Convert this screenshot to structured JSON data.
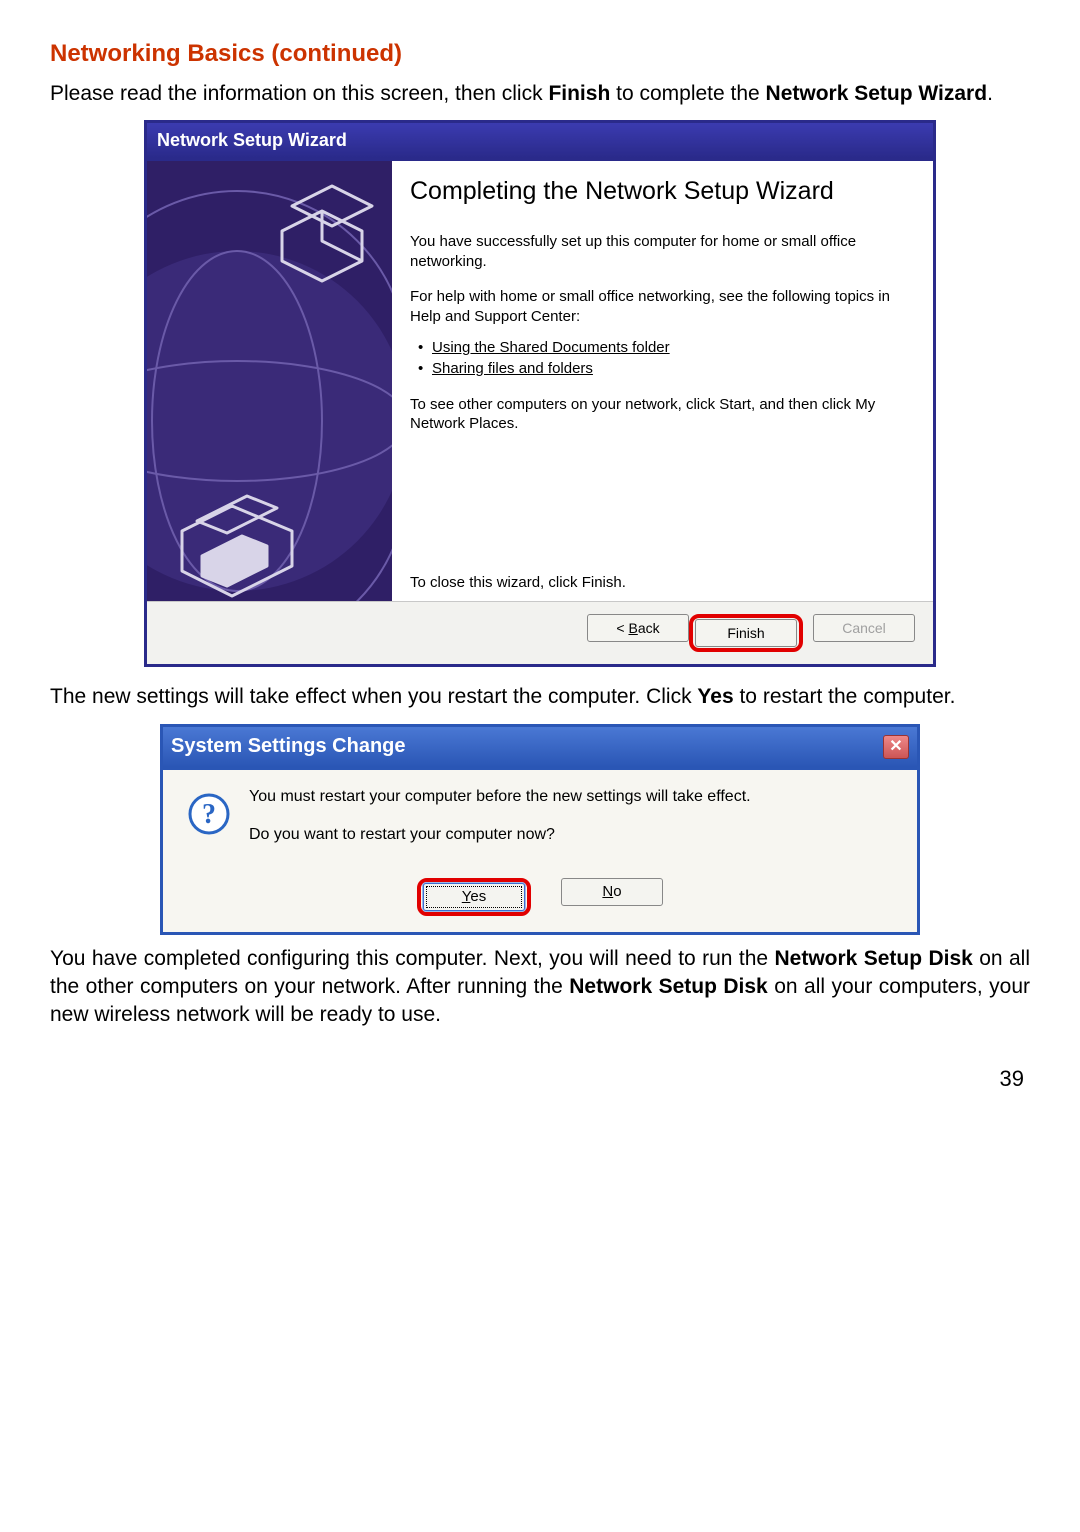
{
  "page": {
    "title": "Networking Basics (continued)",
    "intro_pre": "Please read the information on this screen, then click ",
    "intro_bold1": "Finish",
    "intro_mid": " to complete the ",
    "intro_bold2": "Network Setup Wizard",
    "intro_post": ".",
    "after_wizard_pre": "The new settings will take effect when you restart the computer. Click ",
    "after_wizard_bold": "Yes",
    "after_wizard_post": " to restart the computer.",
    "final_pre": "You have completed configuring this computer. Next, you will need to run the ",
    "final_bold1": "Network Setup Disk",
    "final_mid": " on all the other computers on your network.  After running the ",
    "final_bold2": "Network Setup Disk",
    "final_post": " on all your computers, your new wireless network will be ready to use.",
    "page_number": "39"
  },
  "wizard": {
    "title": "Network Setup Wizard",
    "heading": "Completing the Network Setup Wizard",
    "p1": "You have successfully set up this computer for home or small office networking.",
    "p2": "For help with home or small office networking, see the following topics in Help and Support Center:",
    "links": {
      "l1": "Using the Shared Documents folder",
      "l2": "Sharing files and folders"
    },
    "p3": "To see other computers on your network, click Start, and then click My Network Places.",
    "close_hint": "To close this wizard, click Finish.",
    "buttons": {
      "back_lt": "< ",
      "back_ul": "B",
      "back_rest": "ack",
      "finish": "Finish",
      "cancel": "Cancel"
    }
  },
  "dialog": {
    "title": "System Settings Change",
    "line1": "You must restart your computer before the new settings will take effect.",
    "line2": "Do you want to restart your computer now?",
    "buttons": {
      "yes_ul": "Y",
      "yes_rest": "es",
      "no_ul": "N",
      "no_rest": "o"
    }
  }
}
